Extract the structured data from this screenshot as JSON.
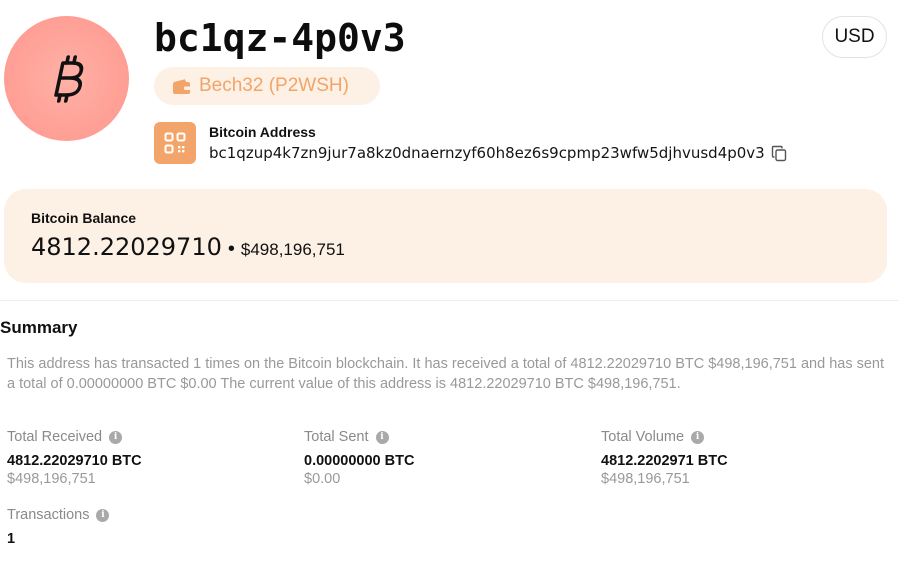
{
  "header": {
    "short_address": "bc1qz-4p0v3",
    "address_type": "Bech32 (P2WSH)",
    "currency": "USD"
  },
  "address": {
    "label": "Bitcoin Address",
    "full": "bc1qzup4k7zn9jur7a8kz0dnaernzyf60h8ez6s9cpmp23wfw5djhvusd4p0v3"
  },
  "balance": {
    "label": "Bitcoin Balance",
    "btc": "4812.22029710",
    "separator": "•",
    "usd": "$498,196,751"
  },
  "summary": {
    "title": "Summary",
    "text": "This address has transacted 1 times on the Bitcoin blockchain. It has received a total of 4812.22029710 BTC $498,196,751 and has sent a total of 0.00000000 BTC $0.00 The current value of this address is 4812.22029710 BTC $498,196,751."
  },
  "stats": {
    "received": {
      "label": "Total Received",
      "value": "4812.22029710 BTC",
      "sub": "$498,196,751"
    },
    "sent": {
      "label": "Total Sent",
      "value": "0.00000000 BTC",
      "sub": "$0.00"
    },
    "volume": {
      "label": "Total Volume",
      "value": "4812.2202971 BTC",
      "sub": "$498,196,751"
    },
    "transactions": {
      "label": "Transactions",
      "value": "1"
    }
  },
  "icons": {
    "avatar": "bitcoin-icon",
    "chip": "wallet-icon",
    "qr": "qr-code-icon",
    "copy": "copy-icon",
    "info": "info-icon"
  },
  "colors": {
    "accent": "#f2a46a",
    "accent_light": "#fdf0e4",
    "avatar": "#ff9e94"
  }
}
